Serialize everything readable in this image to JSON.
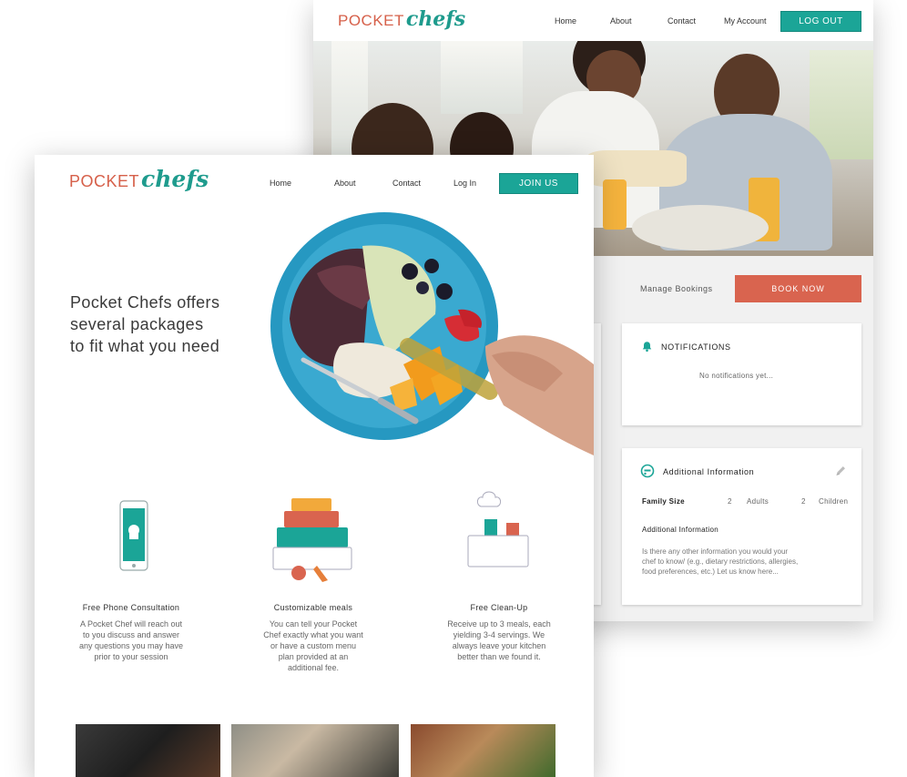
{
  "account_page": {
    "logo": {
      "part1": "POCKET",
      "part2": "chefs"
    },
    "nav": [
      "Home",
      "About",
      "Contact",
      "My Account"
    ],
    "logout_label": "LOG OUT",
    "manage_bookings": "Manage Bookings",
    "book_now": "BOOK NOW",
    "notifications": {
      "title": "NOTIFICATIONS",
      "empty": "No notifications yet..."
    },
    "additional_info": {
      "title": "Additional Information",
      "family_size_label": "Family Size",
      "adults_count": "2",
      "adults_label": "Adults",
      "children_count": "2",
      "children_label": "Children",
      "section_label": "Additional Information",
      "placeholder_lines": [
        "Is there any other information you would your",
        "chef to know/ (e.g., dietary restrictions, allergies,",
        "food preferences, etc.) Let us know here..."
      ]
    }
  },
  "landing_page": {
    "logo": {
      "part1": "POCKET",
      "part2": "chefs"
    },
    "nav": [
      "Home",
      "About",
      "Contact",
      "Log In"
    ],
    "join_label": "JOIN US",
    "tagline": [
      "Pocket Chefs offers",
      "several packages",
      "to fit what you need"
    ],
    "features": [
      {
        "title": "Free Phone Consultation",
        "desc": [
          "A Pocket Chef will reach out",
          "to you discuss and answer",
          "any questions you may have",
          "prior to your session"
        ]
      },
      {
        "title": "Customizable meals",
        "desc": [
          "You can tell your Pocket",
          "Chef exactly what you want",
          "or have a custom menu",
          "plan provided at an",
          "additional fee."
        ]
      },
      {
        "title": "Free Clean-Up",
        "desc": [
          "Receive up to 3 meals, each",
          "yielding 3-4 servings. We",
          "always leave your kitchen",
          "better than we found it."
        ]
      }
    ]
  },
  "colors": {
    "teal": "#1ba597",
    "coral": "#d9644f",
    "logo_orange": "#d6604a"
  }
}
